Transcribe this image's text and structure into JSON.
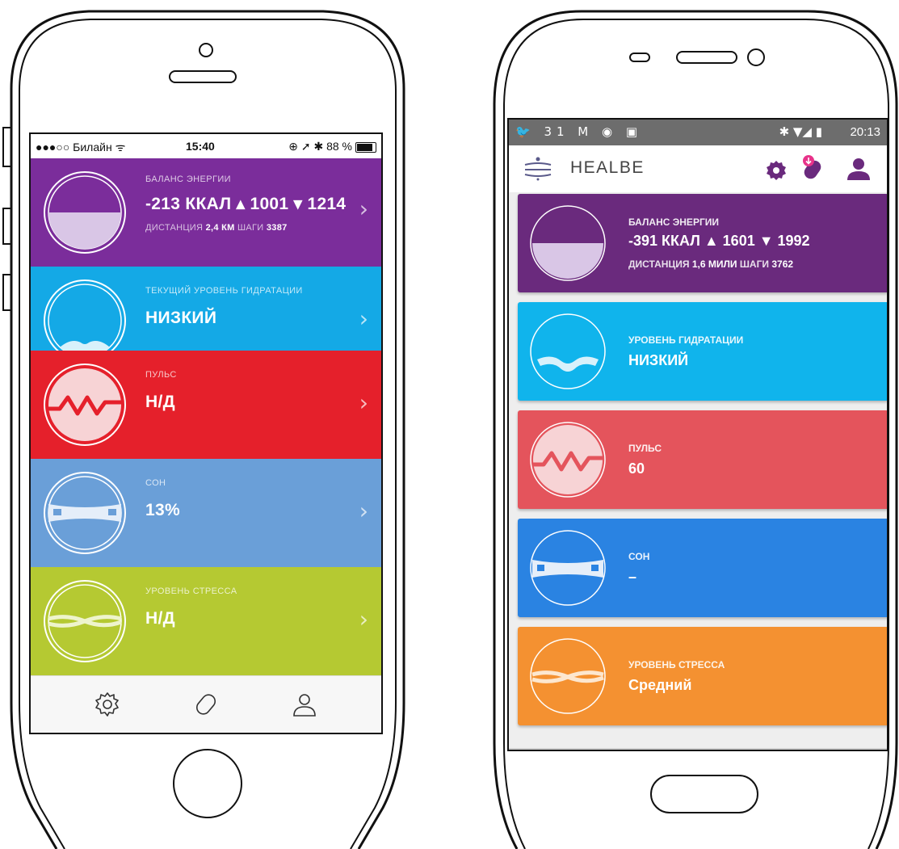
{
  "ios": {
    "status": {
      "carrier": "●●●○○ Билайн ᯤ",
      "time": "15:40",
      "right": "⊕ ➚ ✱ 88 %"
    },
    "cards": [
      {
        "label": "БАЛАНС ЭНЕРГИИ",
        "value": "-213 ККАЛ ▴ 1001 ▾ 1214",
        "sub_label_1": "ДИСТАНЦИЯ",
        "sub_value_1": "2,4 КМ",
        "sub_label_2": "ШАГИ",
        "sub_value_2": "3387",
        "color": "#7b2d9b",
        "icon": "energy-balance-icon"
      },
      {
        "label": "ТЕКУЩИЙ УРОВЕНЬ ГИДРАТАЦИИ",
        "value": "НИЗКИЙ",
        "color": "#14a9e6",
        "icon": "hydration-icon"
      },
      {
        "label": "ПУЛЬС",
        "value": "Н/Д",
        "color": "#e5202b",
        "icon": "pulse-icon"
      },
      {
        "label": "СОН",
        "value": "13%",
        "color": "#6a9fd8",
        "icon": "sleep-icon"
      },
      {
        "label": "УРОВЕНЬ СТРЕССА",
        "value": "Н/Д",
        "color": "#b5c932",
        "icon": "stress-icon"
      }
    ],
    "chevron": "›",
    "tabs": [
      {
        "icon": "settings-icon"
      },
      {
        "icon": "band-icon"
      },
      {
        "icon": "profile-icon"
      }
    ]
  },
  "android": {
    "status": {
      "left": "🐦 31 M ◉ ▣",
      "right": "✱ ▼◢ ▮",
      "time": "20:13"
    },
    "app_title": "HEALBE",
    "cards": [
      {
        "label": "БАЛАНС ЭНЕРГИИ",
        "value": "-391 ККАЛ ▲ 1601 ▼ 1992",
        "sub_label_1": "ДИСТАНЦИЯ",
        "sub_value_1": "1,6 МИЛИ",
        "sub_label_2": "ШАГИ",
        "sub_value_2": "3762",
        "color": "#6a2a7d",
        "icon": "energy-balance-icon"
      },
      {
        "label": "УРОВЕНЬ ГИДРАТАЦИИ",
        "value": "НИЗКИЙ",
        "color": "#10b4ec",
        "icon": "hydration-icon"
      },
      {
        "label": "ПУЛЬС",
        "value": "60",
        "color": "#e4545c",
        "icon": "pulse-icon"
      },
      {
        "label": "СОН",
        "value": "–",
        "color": "#2a83e2",
        "icon": "sleep-icon"
      },
      {
        "label": "УРОВЕНЬ СТРЕССА",
        "value": "Средний",
        "color": "#f49131",
        "icon": "stress-icon"
      }
    ]
  }
}
